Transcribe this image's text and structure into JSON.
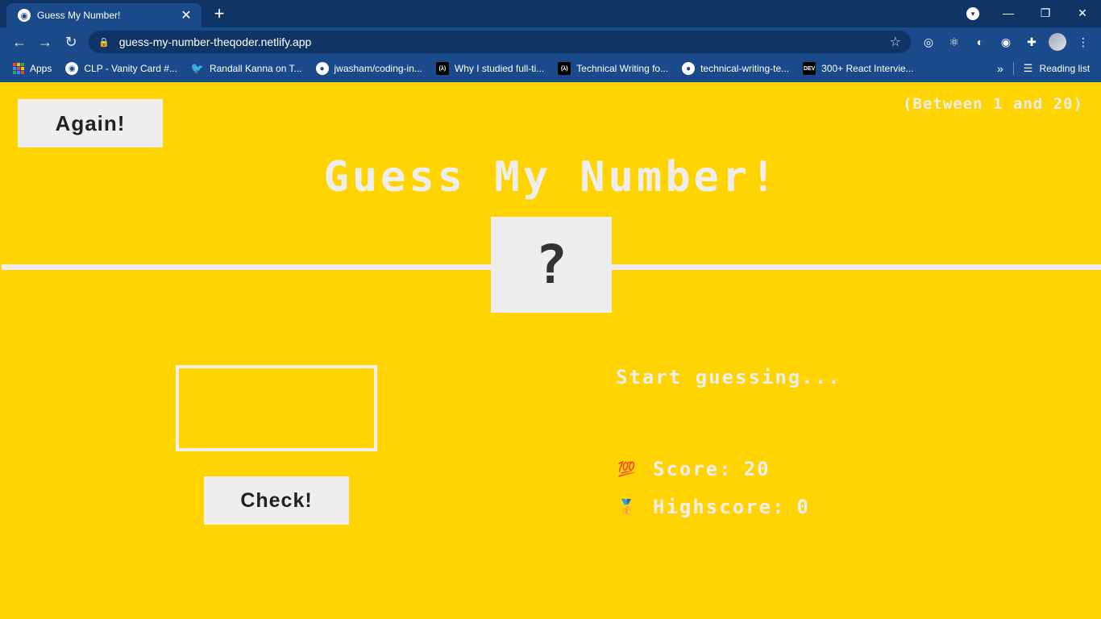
{
  "browser": {
    "tab_title": "Guess My Number!",
    "url": "guess-my-number-theqoder.netlify.app",
    "bookmarks": [
      {
        "label": "Apps",
        "icon": "apps-grid-icon"
      },
      {
        "label": "CLP - Vanity Card #...",
        "icon": "globe-icon"
      },
      {
        "label": "Randall Kanna on T...",
        "icon": "twitter-icon"
      },
      {
        "label": "jwasham/coding-in...",
        "icon": "github-icon"
      },
      {
        "label": "Why I studied full-ti...",
        "icon": "freecodecamp-icon"
      },
      {
        "label": "Technical Writing fo...",
        "icon": "freecodecamp-icon"
      },
      {
        "label": "technical-writing-te...",
        "icon": "github-icon"
      },
      {
        "label": "300+ React Intervie...",
        "icon": "dev-icon"
      }
    ],
    "reading_list": "Reading list"
  },
  "game": {
    "again_label": "Again!",
    "range_hint": "(Between 1 and 20)",
    "title": "Guess My Number!",
    "secret_display": "?",
    "guess_value": "",
    "check_label": "Check!",
    "message": "Start guessing...",
    "score_label": "Score:",
    "score_value": "20",
    "highscore_label": "Highscore:",
    "highscore_value": "0",
    "score_icon": "hundred-points-icon",
    "highscore_icon": "medal-icon"
  },
  "colors": {
    "background": "#ffd400",
    "text": "#eeeeee",
    "button": "#eeeeee",
    "browser_frame": "#1a4a8a"
  }
}
